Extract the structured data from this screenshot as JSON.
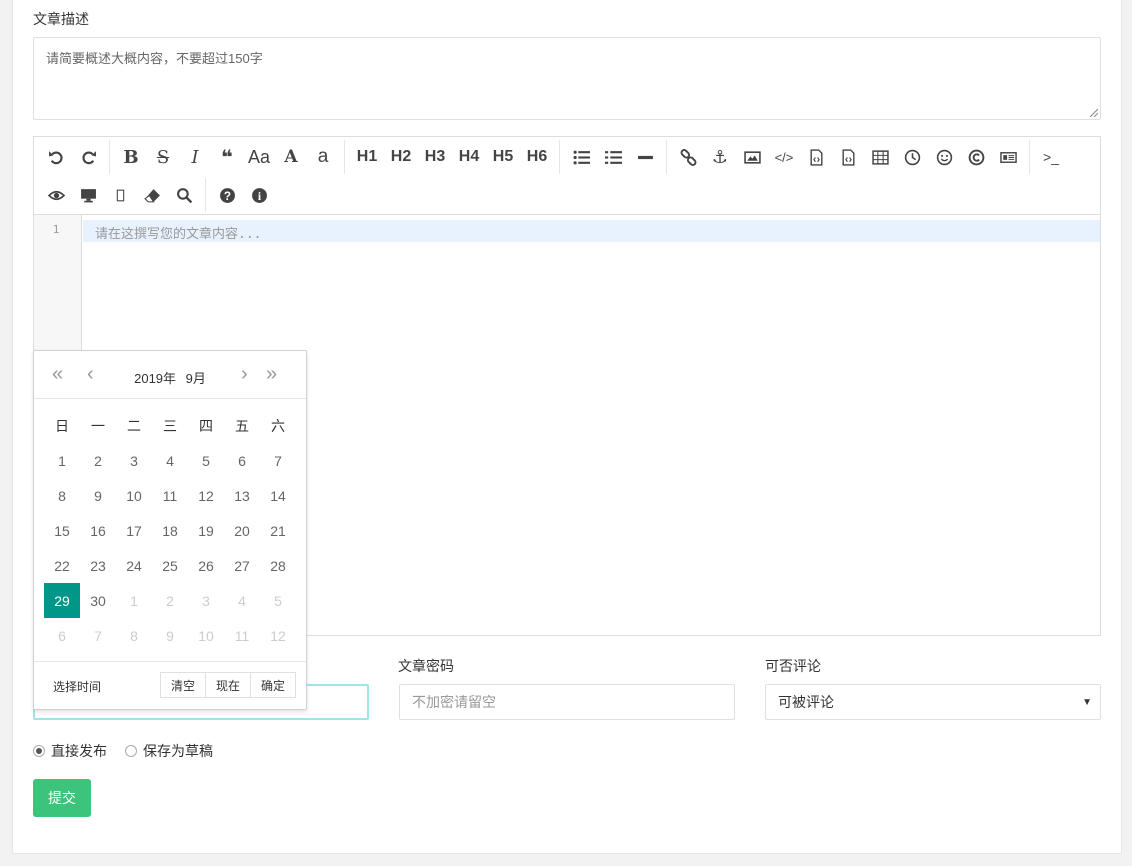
{
  "description": {
    "label": "文章描述",
    "placeholder": "请简要概述大概内容，不要超过150字"
  },
  "editor": {
    "toolbar_row1": [
      {
        "name": "undo-icon",
        "glyph": "↶"
      },
      {
        "name": "redo-icon",
        "glyph": "↷"
      },
      {
        "name": "bold-icon",
        "glyph": "B"
      },
      {
        "name": "strikethrough-icon",
        "glyph": "S"
      },
      {
        "name": "italic-icon",
        "glyph": "I"
      },
      {
        "name": "quote-icon",
        "glyph": "❝"
      },
      {
        "name": "uppercase-icon",
        "glyph": "Aa"
      },
      {
        "name": "uppercase-A-icon",
        "glyph": "A"
      },
      {
        "name": "lowercase-icon",
        "glyph": "a"
      }
    ],
    "headings": [
      "H1",
      "H2",
      "H3",
      "H4",
      "H5",
      "H6"
    ],
    "line_number": "1",
    "placeholder": "请在这撰写您的文章内容..."
  },
  "fields": {
    "password_label": "文章密码",
    "password_placeholder": "不加密请留空",
    "comment_label": "可否评论",
    "comment_value": "可被评论",
    "date_value": "|"
  },
  "radios": {
    "publish": "直接发布",
    "draft": "保存为草稿"
  },
  "submit_label": "提交",
  "calendar": {
    "year": "2019年",
    "month": "9月",
    "weekdays": [
      "日",
      "一",
      "二",
      "三",
      "四",
      "五",
      "六"
    ],
    "weeks": [
      [
        "1",
        "2",
        "3",
        "4",
        "5",
        "6",
        "7"
      ],
      [
        "8",
        "9",
        "10",
        "11",
        "12",
        "13",
        "14"
      ],
      [
        "15",
        "16",
        "17",
        "18",
        "19",
        "20",
        "21"
      ],
      [
        "22",
        "23",
        "24",
        "25",
        "26",
        "27",
        "28"
      ],
      [
        "29",
        "30",
        "1",
        "2",
        "3",
        "4",
        "5"
      ],
      [
        "6",
        "7",
        "8",
        "9",
        "10",
        "11",
        "12"
      ]
    ],
    "selected": "29",
    "footer_label": "选择时间",
    "btn_clear": "清空",
    "btn_now": "现在",
    "btn_ok": "确定"
  },
  "colors": {
    "accent": "#009688",
    "submit": "#3bc47a",
    "focus_border": "#9ee6e6"
  }
}
